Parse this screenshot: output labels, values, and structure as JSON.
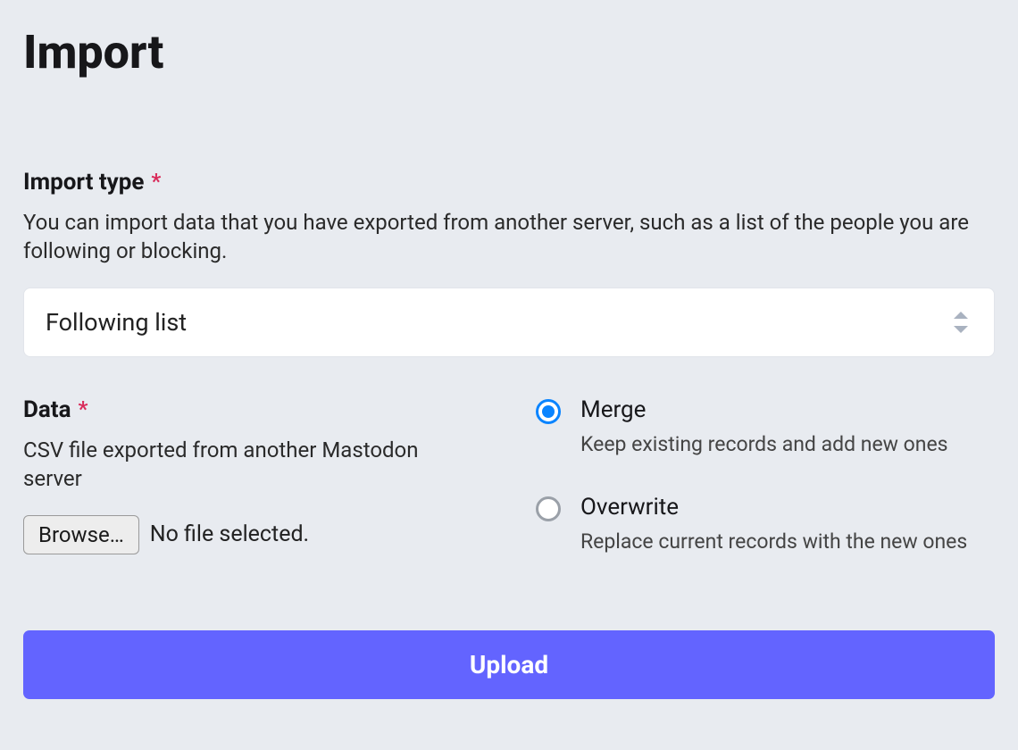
{
  "page": {
    "title": "Import"
  },
  "import_type": {
    "label": "Import type",
    "required_mark": "*",
    "description": "You can import data that you have exported from another server, such as a list of the people you are following or blocking.",
    "selected": "Following list"
  },
  "data_section": {
    "label": "Data",
    "required_mark": "*",
    "description": "CSV file exported from another Mastodon server",
    "browse_label": "Browse…",
    "file_status": "No file selected."
  },
  "mode": {
    "options": [
      {
        "label": "Merge",
        "description": "Keep existing records and add new ones",
        "checked": true
      },
      {
        "label": "Overwrite",
        "description": "Replace current records with the new ones",
        "checked": false
      }
    ]
  },
  "submit": {
    "label": "Upload"
  }
}
